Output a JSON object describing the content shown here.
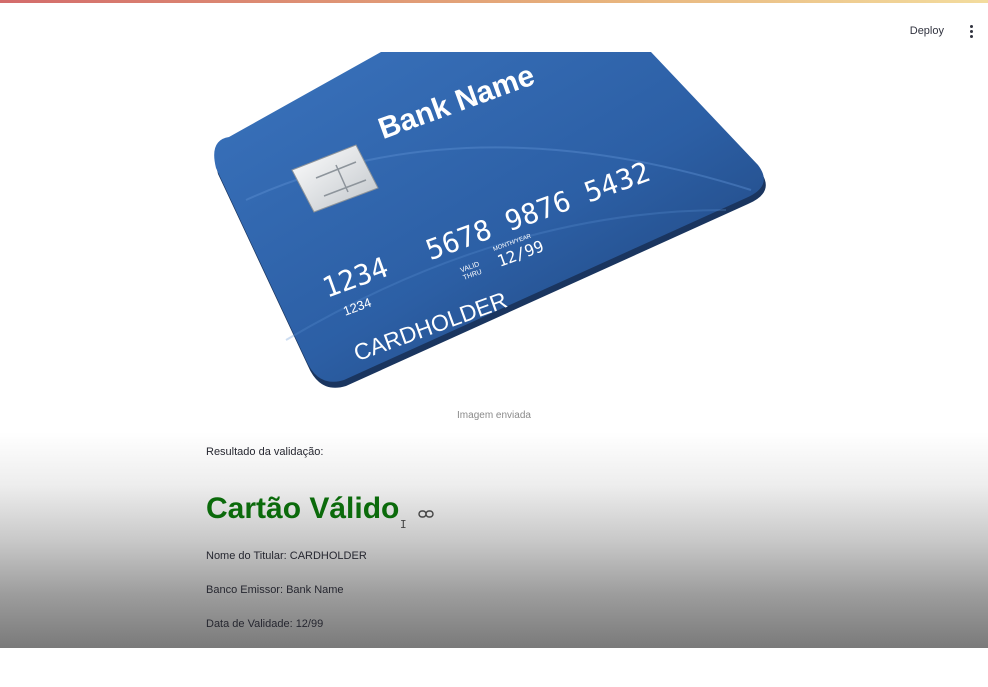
{
  "header": {
    "deploy_label": "Deploy",
    "menu_icon": "kebab-menu-icon"
  },
  "image": {
    "bank_name": "Bank Name",
    "card_number": "5678 9876 5432",
    "card_number_prefix": "1234",
    "card_small_number": "1234",
    "valid_label_top": "VALID",
    "valid_label_bottom": "THRU",
    "month_year_label": "MONTH/YEAR",
    "expiry": "12/99",
    "cardholder": "CARDHOLDER",
    "caption": "Imagem enviada"
  },
  "result": {
    "label": "Resultado da validação:",
    "status": "Cartão Válido",
    "status_color": "#0b6a0b",
    "holder_line": "Nome do Titular: CARDHOLDER",
    "bank_line": "Banco Emissor: Bank Name",
    "expiry_line": "Data de Validade: 12/99",
    "cursor_glyph": "I"
  },
  "colors": {
    "card_blue": "#2c5fa5",
    "card_dark": "#1d3f73",
    "top_bar_start": "#d36b6b",
    "top_bar_end": "#f3dc9e"
  }
}
